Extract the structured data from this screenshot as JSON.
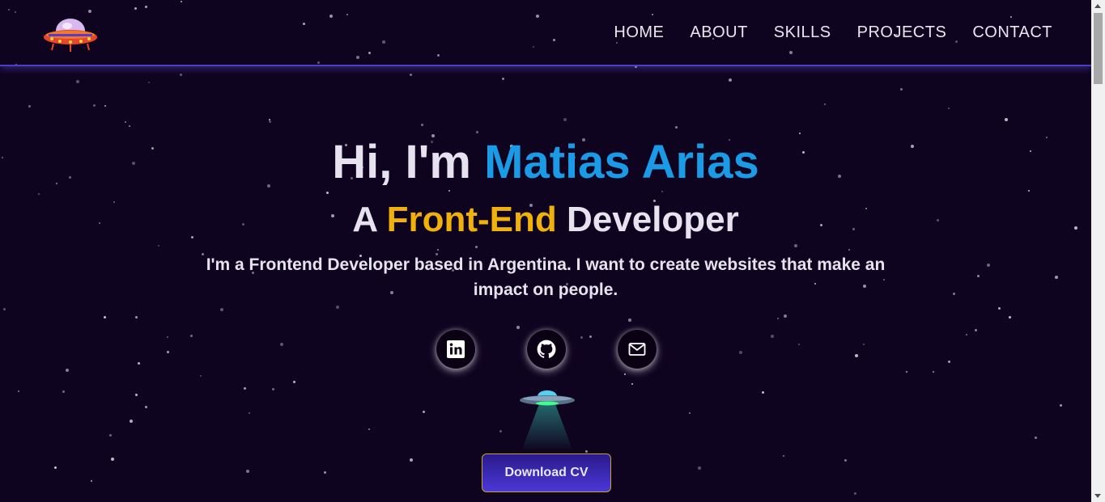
{
  "nav": {
    "items": [
      {
        "label": "HOME"
      },
      {
        "label": "ABOUT"
      },
      {
        "label": "SKILLS"
      },
      {
        "label": "PROJECTS"
      },
      {
        "label": "CONTACT"
      }
    ]
  },
  "hero": {
    "greeting": "Hi, I'm",
    "name": "Matias Arias",
    "role_prefix": "A",
    "role": "Front-End",
    "role_suffix": "Developer",
    "description": "I'm a Frontend Developer based in Argentina. I want to create websites that make an impact on people."
  },
  "socials": [
    {
      "icon": "linkedin-icon"
    },
    {
      "icon": "github-icon"
    },
    {
      "icon": "mail-icon"
    }
  ],
  "cta": {
    "label": "Download CV"
  },
  "colors": {
    "background": "#0f0420",
    "name_accent": "#1b9be6",
    "role_accent": "#f0b10a",
    "header_border": "#4a3fc0",
    "button_gradient_top": "#2a1a8a",
    "button_gradient_bottom": "#4b38d8"
  }
}
